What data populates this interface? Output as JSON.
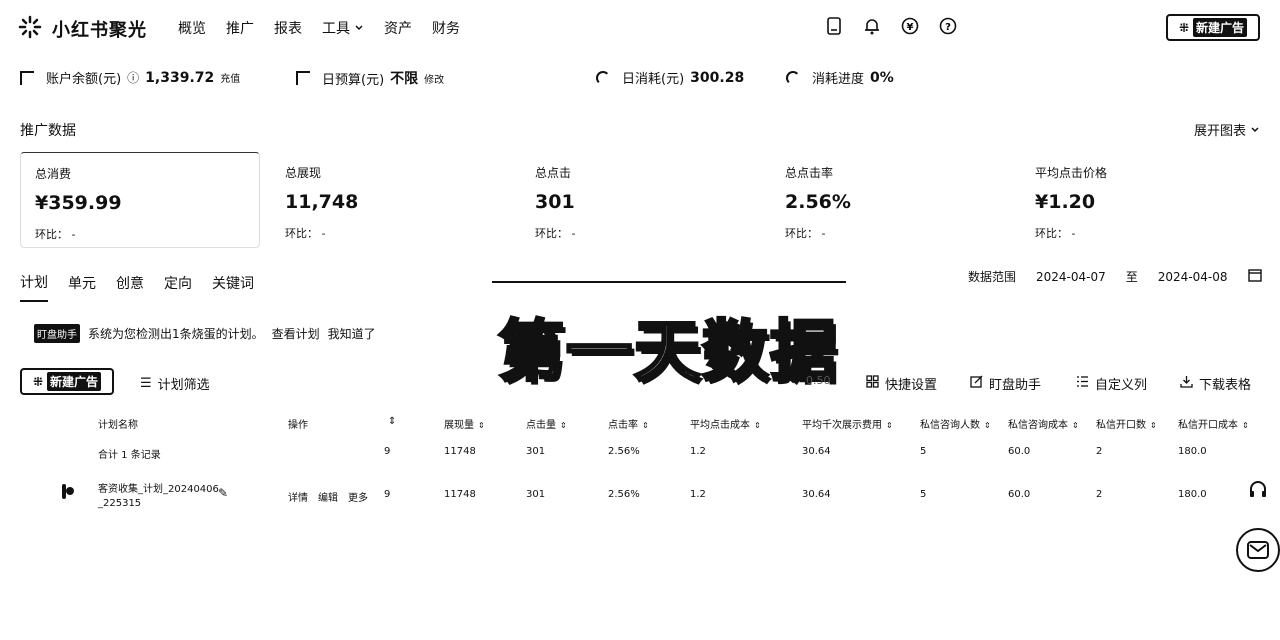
{
  "brand": {
    "name": "小红书聚光"
  },
  "nav": {
    "items": [
      "概览",
      "推广",
      "报表",
      "工具",
      "资产",
      "财务"
    ]
  },
  "header": {
    "new_button": "新建广告"
  },
  "account": {
    "balance_label": "账户余额(元)",
    "balance": "1,339.72",
    "recharge": "充值",
    "budget_label": "日预算(元)",
    "budget": "不限",
    "budget_edit": "修改",
    "spend_label": "日消耗(元)",
    "spend": "300.28",
    "progress_label": "消耗进度",
    "progress": "0%"
  },
  "promo": {
    "title": "推广数据",
    "expand": "展开图表"
  },
  "metrics": [
    {
      "label": "总消费",
      "value": "¥359.99",
      "compare": "环比： -"
    },
    {
      "label": "总展现",
      "value": "11,748",
      "compare": "环比： -"
    },
    {
      "label": "总点击",
      "value": "301",
      "compare": "环比： -"
    },
    {
      "label": "总点击率",
      "value": "2.56%",
      "compare": "环比： -"
    },
    {
      "label": "平均点击价格",
      "value": "¥1.20",
      "compare": "环比： -"
    }
  ],
  "tabs": [
    "计划",
    "单元",
    "创意",
    "定向",
    "关键词"
  ],
  "date_range": {
    "label": "数据范围",
    "start": "2024-04-07",
    "sep": "至",
    "end": "2024-04-08"
  },
  "notice": {
    "tag": "盯盘助手",
    "text": "系统为您检测出1条烧蛋的计划。",
    "view": "查看计划",
    "dismiss": "我知道了"
  },
  "overlay_text": "第一天数据",
  "ghost_text": "0.50",
  "toolbar": {
    "new_button": "新建广告",
    "filter": "计划筛选",
    "quick": "快捷设置",
    "assistant": "盯盘助手",
    "custom": "自定义列",
    "download": "下载表格"
  },
  "table": {
    "headers": [
      "计划名称",
      "操作",
      "展现量",
      "点击量",
      "点击率",
      "平均点击成本",
      "平均千次展示费用",
      "私信咨询人数",
      "私信咨询成本",
      "私信开口数",
      "私信开口成本"
    ],
    "summary": {
      "name": "合计 1 条记录",
      "op": "9",
      "impressions": "11748",
      "clicks": "301",
      "ctr": "2.56%",
      "cpc": "1.2",
      "cpm": "30.64",
      "dm_users": "5",
      "dm_cost": "60.0",
      "open_count": "2",
      "open_cost": "180.0"
    },
    "rows": [
      {
        "name_line1": "客资收集_计划_20240406",
        "name_line2": "_225315",
        "actions": [
          "详情",
          "编辑",
          "更多"
        ],
        "op": "9",
        "impressions": "11748",
        "clicks": "301",
        "ctr": "2.56%",
        "cpc": "1.2",
        "cpm": "30.64",
        "dm_users": "5",
        "dm_cost": "60.0",
        "open_count": "2",
        "open_cost": "180.0"
      }
    ]
  }
}
